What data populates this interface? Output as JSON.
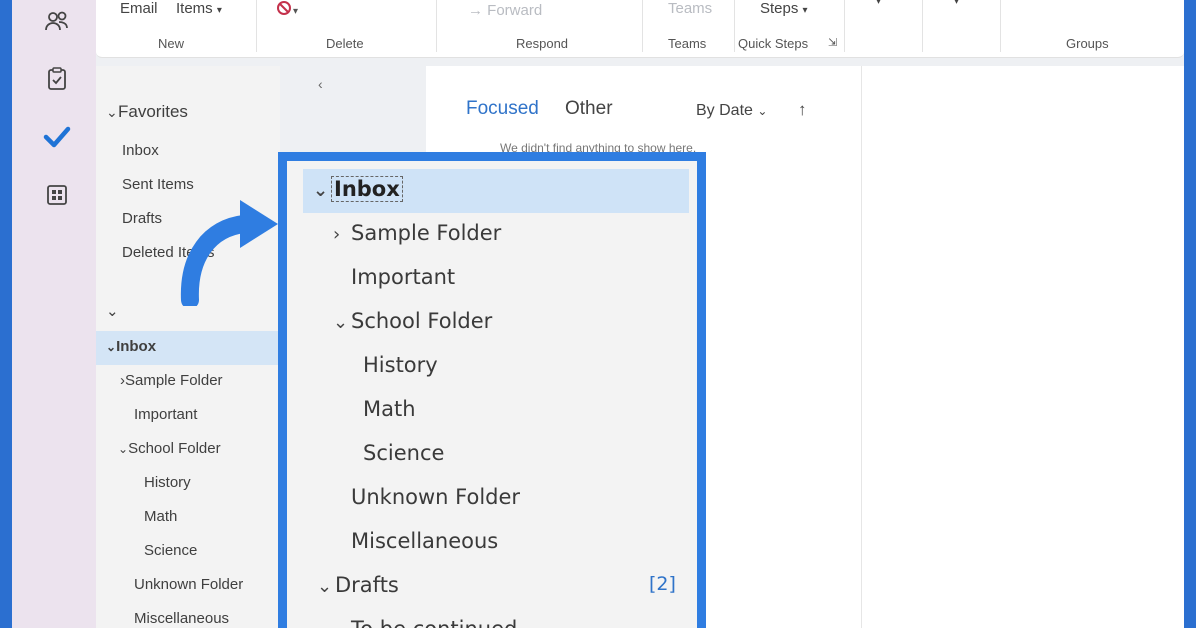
{
  "ribbon": {
    "new_email": "Email",
    "new_items": "Items",
    "forward": "Forward",
    "teams_btn": "Teams",
    "steps_btn": "Steps",
    "groups": {
      "new": "New",
      "delete": "Delete",
      "respond": "Respond",
      "teams": "Teams",
      "quick_steps": "Quick Steps",
      "groups": "Groups"
    }
  },
  "folder_pane": {
    "favorites_header": "Favorites",
    "favorites": [
      "Inbox",
      "Sent Items",
      "Drafts",
      "Deleted Items"
    ],
    "account_header": "",
    "tree": [
      {
        "label": "Inbox",
        "chevron": "v"
      },
      {
        "label": "Sample Folder",
        "chevron": ">"
      },
      {
        "label": "Important",
        "chevron": ""
      },
      {
        "label": "School Folder",
        "chevron": "v"
      },
      {
        "label": "History",
        "chevron": ""
      },
      {
        "label": "Math",
        "chevron": ""
      },
      {
        "label": "Science",
        "chevron": ""
      },
      {
        "label": "Unknown Folder",
        "chevron": ""
      },
      {
        "label": "Miscellaneous",
        "chevron": ""
      }
    ]
  },
  "message_list": {
    "tab_focused": "Focused",
    "tab_other": "Other",
    "sort_label": "By Date",
    "empty_text": "We didn't find anything to show here."
  },
  "zoom": {
    "items": [
      {
        "label": "Inbox",
        "chevron": "v"
      },
      {
        "label": "Sample Folder",
        "chevron": ">"
      },
      {
        "label": "Important",
        "chevron": ""
      },
      {
        "label": "School Folder",
        "chevron": "v"
      },
      {
        "label": "History",
        "chevron": ""
      },
      {
        "label": "Math",
        "chevron": ""
      },
      {
        "label": "Science",
        "chevron": ""
      },
      {
        "label": "Unknown Folder",
        "chevron": ""
      },
      {
        "label": "Miscellaneous",
        "chevron": ""
      },
      {
        "label": "Drafts",
        "chevron": "v"
      },
      {
        "label": "To be continued",
        "chevron": ""
      }
    ],
    "drafts_count": "[2]"
  },
  "colors": {
    "accent": "#2f7de1",
    "selected": "#cfe3f7",
    "checkmark": "#1f73d6"
  }
}
